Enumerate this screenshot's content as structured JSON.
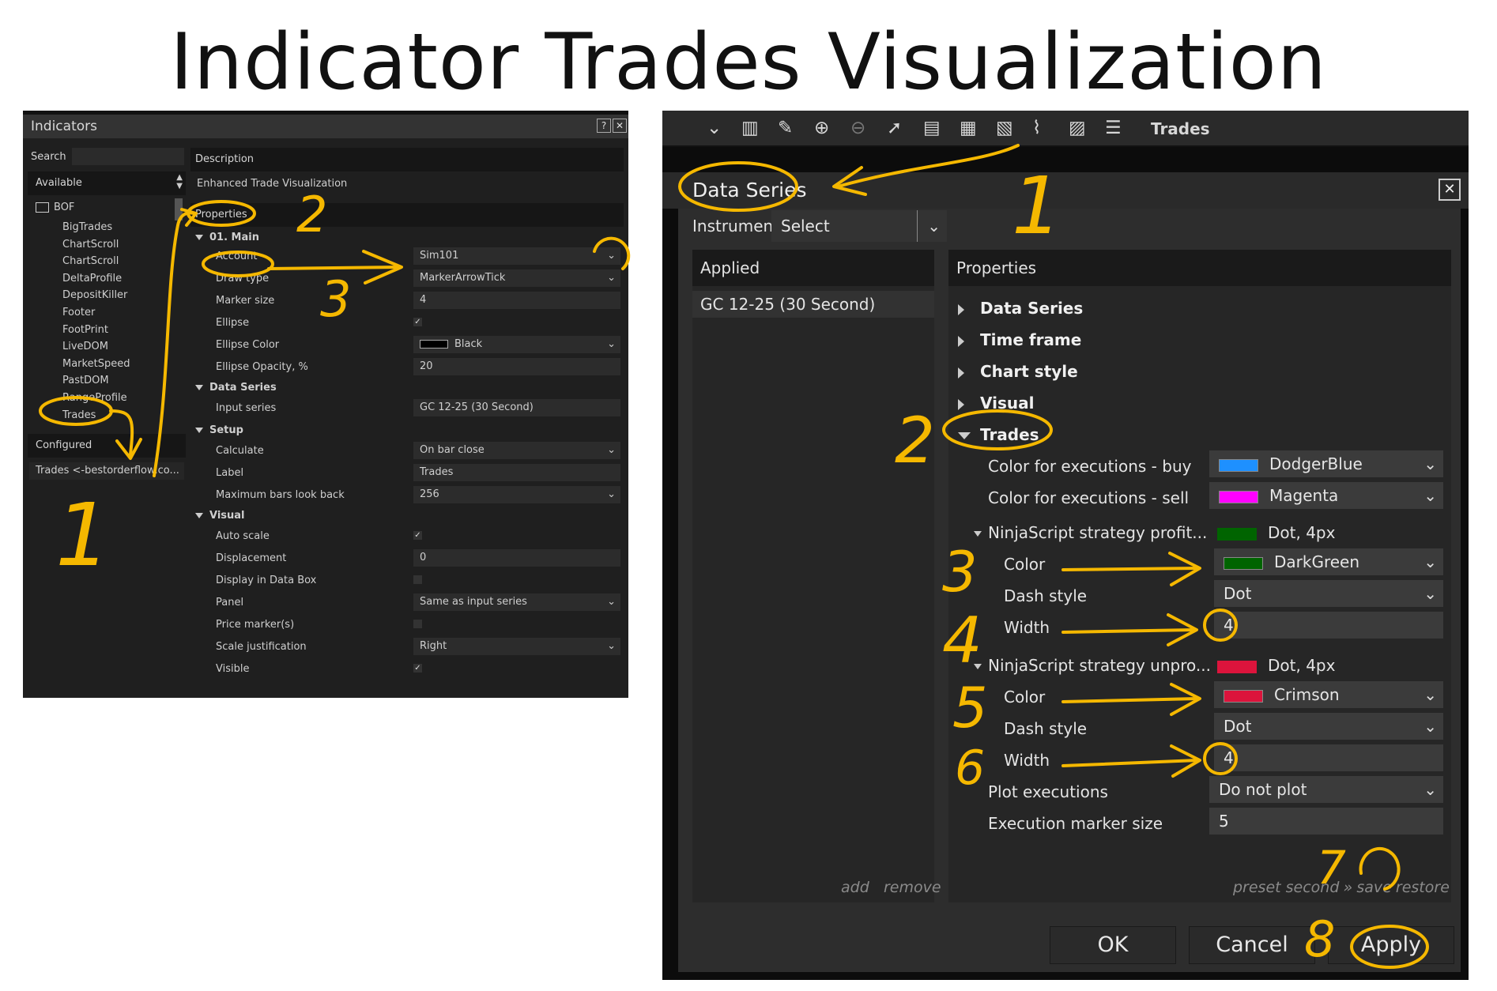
{
  "title": "Indicator Trades Visualization",
  "indicators_window": {
    "title": "Indicators",
    "search_label": "Search",
    "available_label": "Available",
    "folder": "BOF",
    "items": [
      "BigTrades",
      "ChartScroll",
      "ChartScroll",
      "DeltaProfile",
      "DepositKiller",
      "Footer",
      "FootPrint",
      "LiveDOM",
      "MarketSpeed",
      "PastDOM",
      "RangeProfile",
      "Trades"
    ],
    "configured_label": "Configured",
    "configured_item": "Trades <-bestorderflow.co...",
    "description_label": "Description",
    "description_value": "Enhanced Trade Visualization",
    "properties_label": "Properties",
    "groups": {
      "main": "01. Main",
      "data_series": "Data Series",
      "setup": "Setup",
      "visual": "Visual"
    },
    "props": {
      "account": "Account",
      "account_val": "Sim101",
      "draw_type": "Draw type",
      "draw_type_val": "MarkerArrowTick",
      "marker_size": "Marker size",
      "marker_size_val": "4",
      "ellipse": "Ellipse",
      "ellipse_val": "✓",
      "ellipse_color": "Ellipse Color",
      "ellipse_color_val": "Black",
      "ellipse_opacity": "Ellipse Opacity, %",
      "ellipse_opacity_val": "20",
      "input_series": "Input series",
      "input_series_val": "GC 12-25 (30 Second)",
      "calculate": "Calculate",
      "calculate_val": "On bar close",
      "label": "Label",
      "label_val": "Trades",
      "max_bars": "Maximum bars look back",
      "max_bars_val": "256",
      "auto_scale": "Auto scale",
      "auto_scale_val": "✓",
      "displacement": "Displacement",
      "displacement_val": "0",
      "display_data_box": "Display in Data Box",
      "panel": "Panel",
      "panel_val": "Same as input series",
      "price_markers": "Price marker(s)",
      "scale_just": "Scale justification",
      "scale_just_val": "Right",
      "visible": "Visible",
      "visible_val": "✓"
    }
  },
  "data_series_window": {
    "toolbar_label": "Trades",
    "title": "Data Series",
    "instrument_label": "Instrument",
    "instrument_value": "Select",
    "applied_label": "Applied",
    "applied_item": "GC 12-25 (30 Second)",
    "properties_label": "Properties",
    "collapsed_groups": [
      "Data Series",
      "Time frame",
      "Chart style",
      "Visual"
    ],
    "trades_group": "Trades",
    "rows": {
      "buy_color": "Color for executions - buy",
      "buy_color_val": "DodgerBlue",
      "sell_color": "Color for executions - sell",
      "sell_color_val": "Magenta",
      "profit_group": "NinjaScript strategy profit...",
      "profit_summary": "Dot, 4px",
      "color": "Color",
      "profit_color_val": "DarkGreen",
      "dash_style": "Dash style",
      "dash_val": "Dot",
      "width": "Width",
      "width_val": "4",
      "unprofit_group": "NinjaScript strategy unpro...",
      "unprofit_summary": "Dot, 4px",
      "unprofit_color_val": "Crimson",
      "plot_exec": "Plot executions",
      "plot_exec_val": "Do not plot",
      "marker_size": "Execution marker size",
      "marker_size_val": "5"
    },
    "add": "add",
    "remove": "remove",
    "preset": "preset second",
    "preset_sep": "»",
    "save": "save",
    "restore": "restore",
    "ok": "OK",
    "cancel": "Cancel",
    "apply": "Apply"
  },
  "annotation_numbers": [
    "1",
    "2",
    "3",
    "1",
    "2",
    "3",
    "4",
    "5",
    "6",
    "7",
    "8"
  ],
  "colors": {
    "annotation": "#f5b800",
    "dodgerblue": "#1e90ff",
    "magenta": "#ff00ff",
    "darkgreen": "#006400",
    "crimson": "#dc143c"
  }
}
